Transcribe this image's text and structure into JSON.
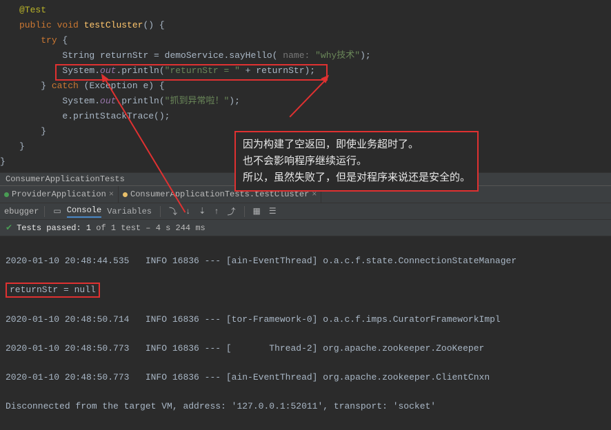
{
  "code": {
    "annotation": "@Test",
    "signature_kw1": "public void",
    "signature_name": "testCluster",
    "signature_paren": "() {",
    "try_kw": "try",
    "try_brace": " {",
    "line1_type": "String ",
    "line1_var": "returnStr = ",
    "line1_call": "demoService.sayHello(",
    "line1_hint": " name: ",
    "line1_str": "\"why技术\"",
    "line1_end": ");",
    "line2_sys": "System.",
    "line2_out": "out",
    "line2_println": ".println(",
    "line2_str": "\"returnStr = \"",
    "line2_plus": " + returnStr);",
    "catch_brace": "} ",
    "catch_kw": "catch",
    "catch_rest": " (Exception e) {",
    "line3_sys": "System.",
    "line3_out": "out",
    "line3_println": ".println(",
    "line3_str": "\"抓到异常啦！\"",
    "line3_end": ");",
    "line4": "e.printStackTrace();",
    "close1": "}",
    "close2": "}",
    "close3": "}"
  },
  "annotation": {
    "line1": "因为构建了空返回，即使业务超时了。",
    "line2": "也不会影响程序继续运行。",
    "line3": "所以，虽然失败了，但是对程序来说还是安全的。"
  },
  "crumb": "ConsumerApplicationTests",
  "tabs": {
    "t1": "ProviderApplication",
    "t2": "ConsumerApplicationTests.testCluster"
  },
  "toolbar": {
    "debugger": "ebugger",
    "console": "Console",
    "variables": "Variables"
  },
  "status": {
    "text": "Tests passed: 1",
    "rest": " of 1 test – 4 s 244 ms"
  },
  "console": {
    "l1": "2020-01-10 20:48:44.535   INFO 16836 --- [ain-EventThread] o.a.c.f.state.ConnectionStateManager",
    "l2": "returnStr = null",
    "l3": "2020-01-10 20:48:50.714   INFO 16836 --- [tor-Framework-0] o.a.c.f.imps.CuratorFrameworkImpl",
    "l4": "2020-01-10 20:48:50.773   INFO 16836 --- [       Thread-2] org.apache.zookeeper.ZooKeeper",
    "l5": "2020-01-10 20:48:50.773   INFO 16836 --- [ain-EventThread] org.apache.zookeeper.ClientCnxn",
    "l6": "Disconnected from the target VM, address: '127.0.0.1:52011', transport: 'socket'"
  }
}
